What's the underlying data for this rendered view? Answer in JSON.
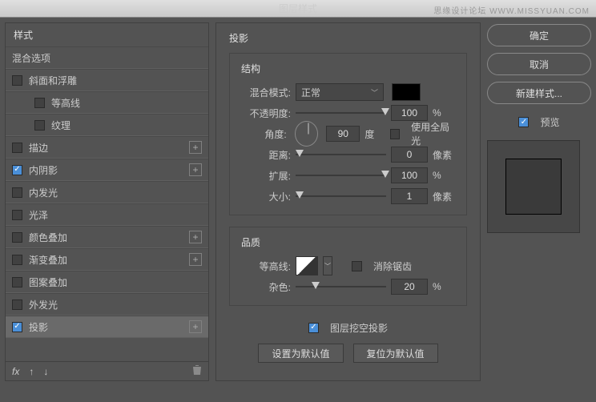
{
  "title": "图层样式",
  "watermark": "思缘设计论坛  WWW.MISSYUAN.COM",
  "left": {
    "header": "样式",
    "blend_options": "混合选项",
    "items": [
      {
        "label": "斜面和浮雕",
        "checked": false,
        "add": false
      },
      {
        "label": "等高线",
        "checked": false,
        "indent": true
      },
      {
        "label": "纹理",
        "checked": false,
        "indent": true
      },
      {
        "label": "描边",
        "checked": false,
        "add": true
      },
      {
        "label": "内阴影",
        "checked": true,
        "add": true
      },
      {
        "label": "内发光",
        "checked": false,
        "add": false
      },
      {
        "label": "光泽",
        "checked": false,
        "add": false
      },
      {
        "label": "颜色叠加",
        "checked": false,
        "add": true
      },
      {
        "label": "渐变叠加",
        "checked": false,
        "add": true
      },
      {
        "label": "图案叠加",
        "checked": false,
        "add": false
      },
      {
        "label": "外发光",
        "checked": false,
        "add": false
      },
      {
        "label": "投影",
        "checked": true,
        "add": true,
        "selected": true
      }
    ]
  },
  "center": {
    "title": "投影",
    "structure": {
      "title": "结构",
      "blend_mode_label": "混合模式:",
      "blend_mode_value": "正常",
      "opacity_label": "不透明度:",
      "opacity_value": "100",
      "opacity_unit": "%",
      "angle_label": "角度:",
      "angle_value": "90",
      "angle_unit": "度",
      "global_light_label": "使用全局光",
      "distance_label": "距离:",
      "distance_value": "0",
      "distance_unit": "像素",
      "spread_label": "扩展:",
      "spread_value": "100",
      "spread_unit": "%",
      "size_label": "大小:",
      "size_value": "1",
      "size_unit": "像素"
    },
    "quality": {
      "title": "品质",
      "contour_label": "等高线:",
      "antialias_label": "消除锯齿",
      "noise_label": "杂色:",
      "noise_value": "20",
      "noise_unit": "%"
    },
    "knockout_label": "图层挖空投影",
    "make_default": "设置为默认值",
    "reset_default": "复位为默认值"
  },
  "right": {
    "ok": "确定",
    "cancel": "取消",
    "new_style": "新建样式...",
    "preview": "预览"
  },
  "footer": {
    "fx": "fx"
  }
}
